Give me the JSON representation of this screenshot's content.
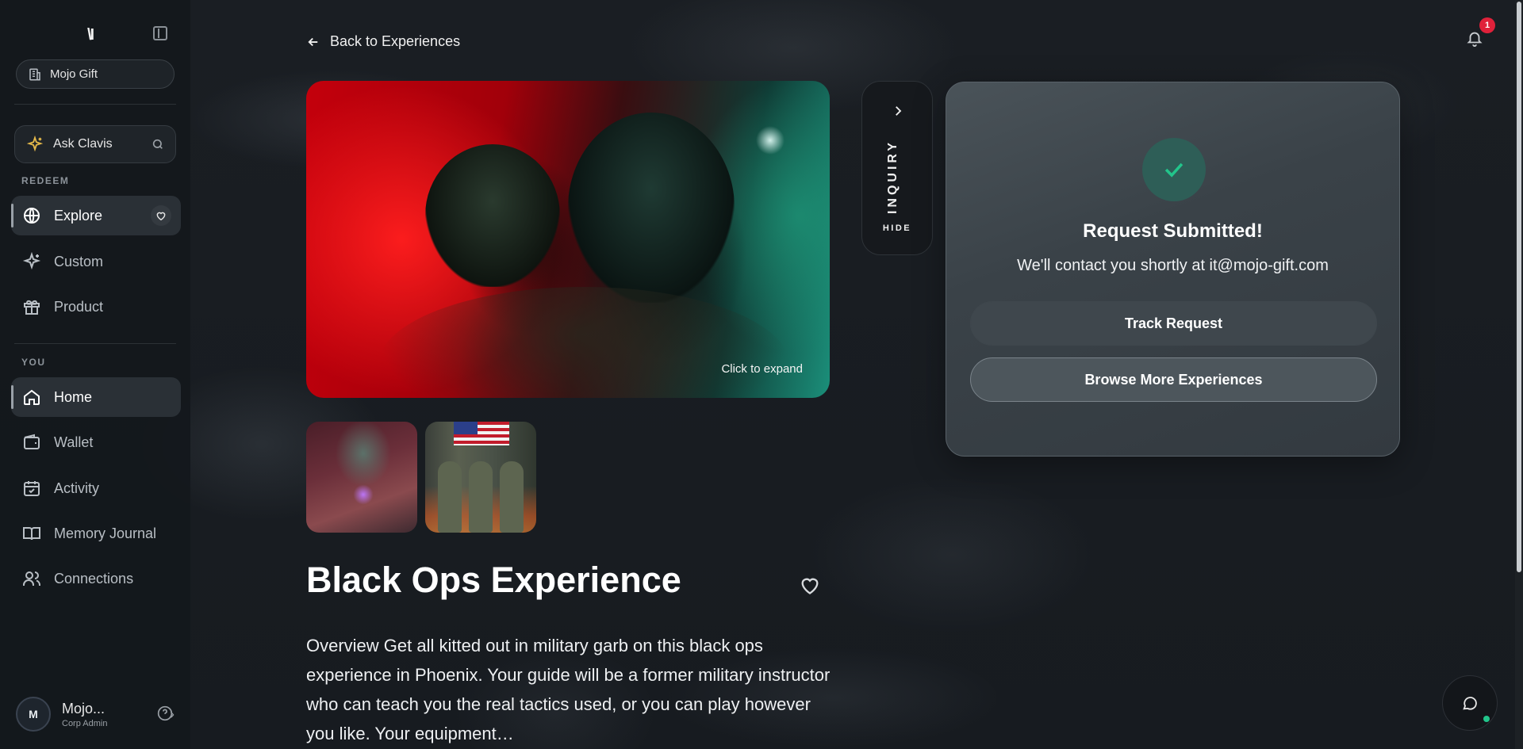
{
  "sidebar": {
    "logo": "\\I",
    "org_name": "Mojo Gift",
    "ask": {
      "label": "Ask Clavis"
    },
    "sections": {
      "redeem": "REDEEM",
      "you": "YOU"
    },
    "redeem_items": [
      {
        "label": "Explore",
        "icon": "globe-icon",
        "active": true
      },
      {
        "label": "Custom",
        "icon": "sparkles-icon"
      },
      {
        "label": "Product",
        "icon": "gift-icon"
      }
    ],
    "you_items": [
      {
        "label": "Home",
        "icon": "home-icon",
        "active": true
      },
      {
        "label": "Wallet",
        "icon": "wallet-icon"
      },
      {
        "label": "Activity",
        "icon": "calendar-check-icon"
      },
      {
        "label": "Memory Journal",
        "icon": "book-icon"
      },
      {
        "label": "Connections",
        "icon": "users-icon"
      }
    ],
    "user": {
      "initial": "M",
      "name": "Mojo...",
      "role": "Corp Admin"
    }
  },
  "main": {
    "back_label": "Back to Experiences",
    "hero_hint": "Click to expand",
    "title": "Black Ops Experience",
    "description": "Overview Get all kitted out in military garb on this black ops experience in Phoenix. Your guide will be a former military instructor who can teach you the real tactics used, or you can play however you like. Your equipment…"
  },
  "inquiry": {
    "label": "INQUIRY",
    "hide": "HIDE"
  },
  "confirmation": {
    "title": "Request Submitted!",
    "subtitle": "We'll contact you shortly at it@mojo-gift.com",
    "track_button": "Track Request",
    "browse_button": "Browse More Experiences"
  },
  "notifications": {
    "count": "1"
  },
  "colors": {
    "accent_green": "#22c58b",
    "badge_red": "#e0213a",
    "card_bg": "#3a4248"
  }
}
